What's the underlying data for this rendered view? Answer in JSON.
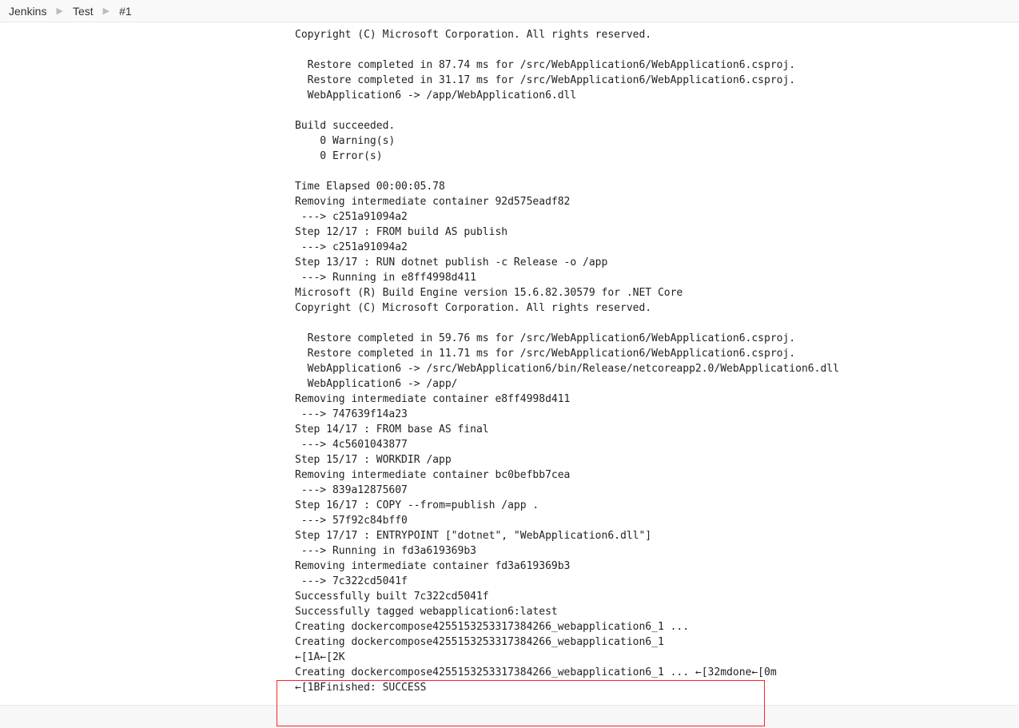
{
  "breadcrumb": {
    "items": [
      {
        "label": "Jenkins"
      },
      {
        "label": "Test"
      },
      {
        "label": "#1"
      }
    ]
  },
  "console": {
    "lines": [
      "Copyright (C) Microsoft Corporation. All rights reserved.",
      "",
      "  Restore completed in 87.74 ms for /src/WebApplication6/WebApplication6.csproj.",
      "  Restore completed in 31.17 ms for /src/WebApplication6/WebApplication6.csproj.",
      "  WebApplication6 -> /app/WebApplication6.dll",
      "",
      "Build succeeded.",
      "    0 Warning(s)",
      "    0 Error(s)",
      "",
      "Time Elapsed 00:00:05.78",
      "Removing intermediate container 92d575eadf82",
      " ---> c251a91094a2",
      "Step 12/17 : FROM build AS publish",
      " ---> c251a91094a2",
      "Step 13/17 : RUN dotnet publish -c Release -o /app",
      " ---> Running in e8ff4998d411",
      "Microsoft (R) Build Engine version 15.6.82.30579 for .NET Core",
      "Copyright (C) Microsoft Corporation. All rights reserved.",
      "",
      "  Restore completed in 59.76 ms for /src/WebApplication6/WebApplication6.csproj.",
      "  Restore completed in 11.71 ms for /src/WebApplication6/WebApplication6.csproj.",
      "  WebApplication6 -> /src/WebApplication6/bin/Release/netcoreapp2.0/WebApplication6.dll",
      "  WebApplication6 -> /app/",
      "Removing intermediate container e8ff4998d411",
      " ---> 747639f14a23",
      "Step 14/17 : FROM base AS final",
      " ---> 4c5601043877",
      "Step 15/17 : WORKDIR /app",
      "Removing intermediate container bc0befbb7cea",
      " ---> 839a12875607",
      "Step 16/17 : COPY --from=publish /app .",
      " ---> 57f92c84bff0",
      "Step 17/17 : ENTRYPOINT [\"dotnet\", \"WebApplication6.dll\"]",
      " ---> Running in fd3a619369b3",
      "Removing intermediate container fd3a619369b3",
      " ---> 7c322cd5041f",
      "Successfully built 7c322cd5041f",
      "Successfully tagged webapplication6:latest",
      "Creating dockercompose4255153253317384266_webapplication6_1 ... ",
      "Creating dockercompose4255153253317384266_webapplication6_1",
      "←[1A←[2K",
      "Creating dockercompose4255153253317384266_webapplication6_1 ... ←[32mdone←[0m",
      "←[1BFinished: SUCCESS"
    ]
  }
}
